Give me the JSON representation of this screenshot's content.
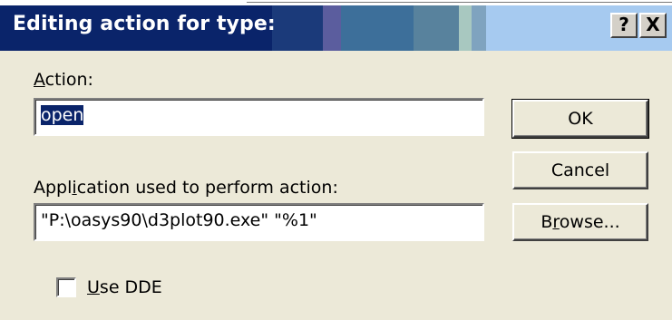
{
  "window": {
    "title": "Editing action for type:",
    "help_button": "?",
    "close_button": "X"
  },
  "action": {
    "label_prefix": "",
    "label_mnemonic": "A",
    "label_rest": "ction:",
    "value": "open"
  },
  "application": {
    "label_prefix": "Appl",
    "label_mnemonic": "i",
    "label_rest": "cation used to perform action:",
    "value": "\"P:\\oasys90\\d3plot90.exe\" \"%1\""
  },
  "buttons": {
    "ok": "OK",
    "cancel": "Cancel",
    "browse_prefix": "B",
    "browse_mnemonic": "r",
    "browse_rest": "owse..."
  },
  "use_dde": {
    "label_mnemonic": "U",
    "label_rest": "se DDE",
    "checked": false
  },
  "colors": {
    "title_bar": "#0a246a",
    "dialog_face": "#ece9d8",
    "selection": "#0a246a"
  }
}
